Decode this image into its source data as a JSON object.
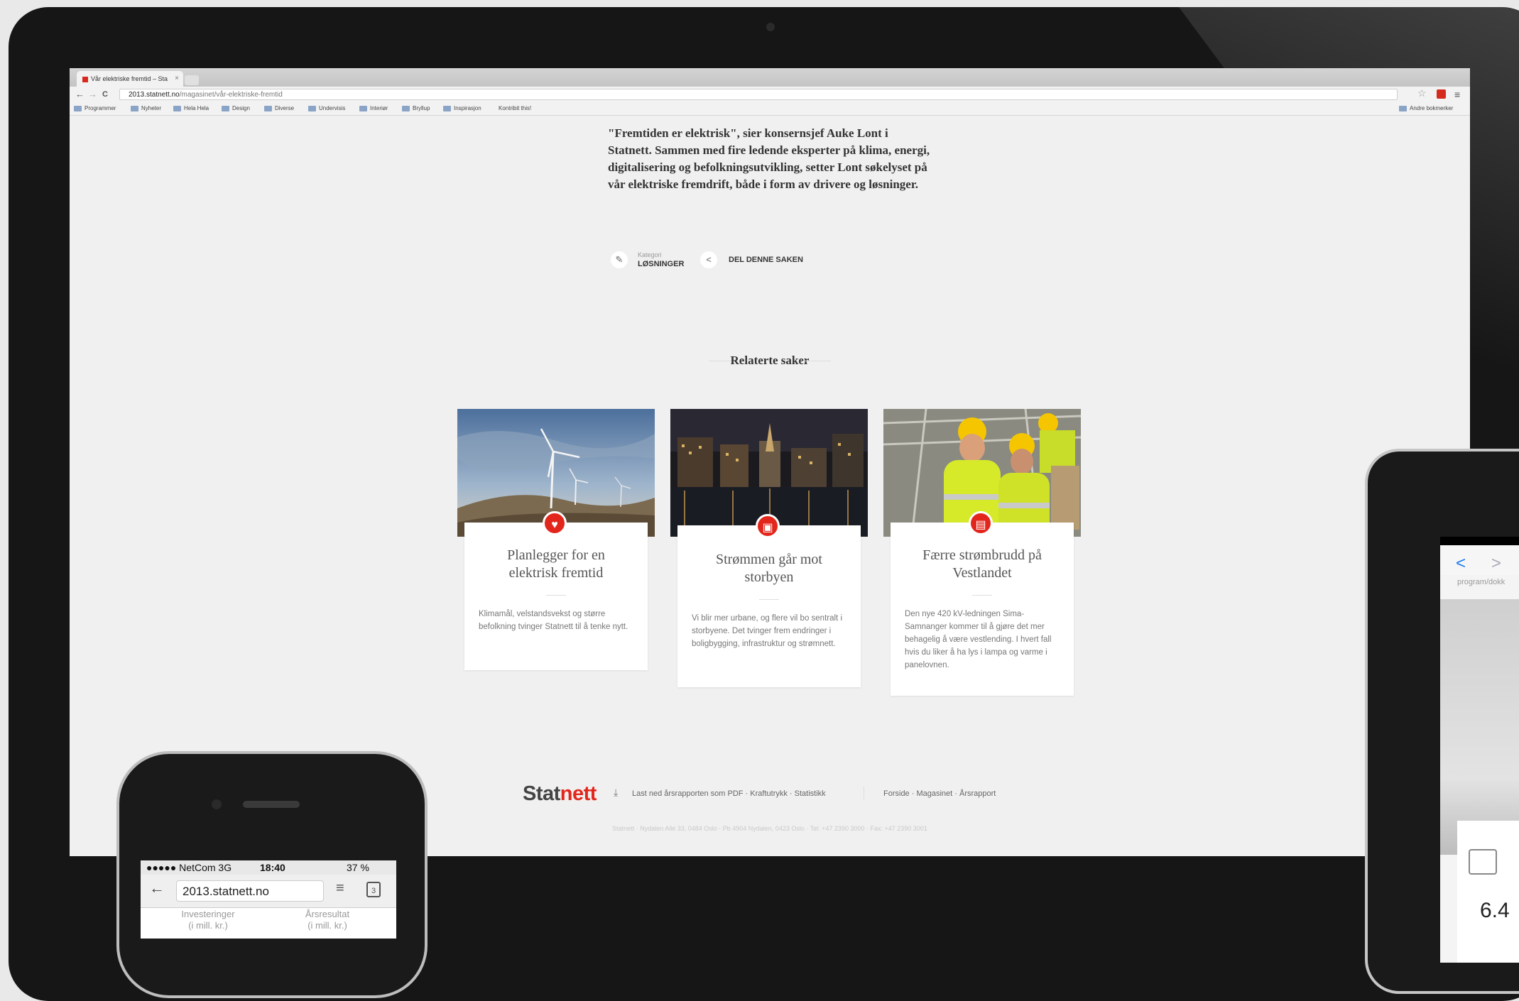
{
  "browser": {
    "tab_title": "Vår elektriske fremtid – Sta",
    "tab_close": "×",
    "url_domain": "2013.statnett.no",
    "url_path": "/magasinet/vår-elektriske-fremtid",
    "nav_back": "←",
    "nav_forward": "→",
    "nav_reload": "C",
    "star_icon": "☆",
    "menu_icon": "≡",
    "bookmarks": [
      "Programmer",
      "Nyheter",
      "Hela Hela",
      "Design",
      "Diverse",
      "Undervisis",
      "Interiør",
      "Bryllup",
      "Inspirasjon",
      "Kontribit this!"
    ],
    "other_bookmarks": "Andre bokmerker"
  },
  "article": {
    "intro": "\"Fremtiden er elektrisk\", sier konsernsjef Auke Lont i Statnett. Sammen med fire ledende eksperter på klima, energi, digitalisering og befolkningsutvikling, setter Lont søkelyset på vår elektriske fremdrift, både i form av drivere og løsninger.",
    "category_label": "Kategori",
    "category_value": "LØSNINGER",
    "share_label": "DEL DENNE SAKEN",
    "tag_icon": "✎",
    "share_icon": "<"
  },
  "related": {
    "title": "Relaterte saker",
    "cards": [
      {
        "title": "Planlegger for en elektrisk fremtid",
        "text": "Klimamål, velstandsvekst og større befolkning tvinger Statnett til å tenke nytt.",
        "icon": "♥"
      },
      {
        "title": "Strømmen går mot storbyen",
        "text": "Vi blir mer urbane, og flere vil bo sentralt i storbyene. Det tvinger frem endringer i boligbygging, infrastruktur og strømnett.",
        "icon": "▣"
      },
      {
        "title": "Færre strømbrudd på Vestlandet",
        "text": "Den nye 420 kV-ledningen Sima-Samnanger kommer til å gjøre det mer behagelig å være vestlending. I hvert fall hvis du liker å ha lys i lampa og varme i panelovnen.",
        "icon": "▤"
      }
    ]
  },
  "footer": {
    "logo_dark": "Stat",
    "logo_red": "nett",
    "download_icon": "⤓",
    "links_left": "Last ned årsrapporten som PDF  ·  Kraftutrykk  ·  Statistikk",
    "links_right": "Forside  ·  Magasinet  ·  Årsrapport",
    "address": "Statnett  ·  Nydalen Allé 33, 0484 Oslo  ·  Pb 4904 Nydalen, 0423 Oslo  ·  Tel: +47 2390 3000  ·  Fax: +47 2390 3001"
  },
  "iphone": {
    "carrier": "●●●●● NetCom  3G",
    "time": "18:40",
    "battery": "37 %",
    "url": "2013.statnett.no",
    "back_icon": "←",
    "menu_icon": "≡",
    "tabs_count": "3",
    "col1": "Investeringer\n(i mill. kr.)",
    "col2": "Årsresultat\n(i mill. kr.)"
  },
  "ipad": {
    "back_icon": "<",
    "forward_icon": ">",
    "url_fragment": "program/dokk",
    "number": "6.4"
  },
  "device": {
    "apple_logo": ""
  }
}
